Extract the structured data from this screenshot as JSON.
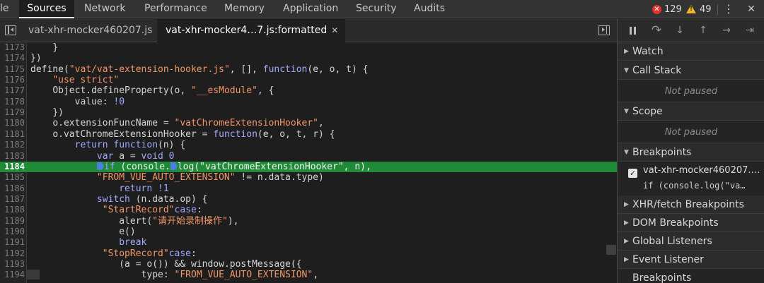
{
  "top_tabs": [
    {
      "label": "le"
    },
    {
      "label": "Sources"
    },
    {
      "label": "Network"
    },
    {
      "label": "Performance"
    },
    {
      "label": "Memory"
    },
    {
      "label": "Application"
    },
    {
      "label": "Security"
    },
    {
      "label": "Audits"
    }
  ],
  "status": {
    "errors": "129",
    "warnings": "49"
  },
  "top_icons": {
    "more": "⋮",
    "close": "✕"
  },
  "file_tabs": [
    {
      "label": "vat-xhr-mocker460207.js"
    },
    {
      "label": "vat-xhr-mocker4…7.js:formatted",
      "close": "✕"
    }
  ],
  "code_lines": [
    {
      "num": "1173",
      "indent": "    ",
      "text": "}"
    },
    {
      "num": "1174",
      "indent": "",
      "text": "})"
    },
    {
      "num": "1175",
      "indent": "",
      "pre": "define(",
      "str1": "\"vat/vat-extension-hooker.js\"",
      "mid": ", [], ",
      "kw": "function",
      "post": "(e, o, t) {"
    },
    {
      "num": "1176",
      "indent": "    ",
      "str1": "\"use strict\""
    },
    {
      "num": "1177",
      "indent": "    ",
      "pre": "Object.defineProperty(o, ",
      "str1": "\"__esModule\"",
      "post": ", {"
    },
    {
      "num": "1178",
      "indent": "        ",
      "pre": "value: ",
      "num1": "!0"
    },
    {
      "num": "1179",
      "indent": "    ",
      "text": "})"
    },
    {
      "num": "1180",
      "indent": "    ",
      "pre": "o.extensionFuncName = ",
      "str1": "\"vatChromeExtensionHooker\"",
      "post": ","
    },
    {
      "num": "1181",
      "indent": "    ",
      "pre": "o.vatChromeExtensionHooker = ",
      "kw": "function",
      "post": "(e, o, t, r) {"
    },
    {
      "num": "1182",
      "indent": "        ",
      "kw": "return function",
      "post": "(n) {"
    },
    {
      "num": "1183",
      "indent": "            ",
      "kw": "var",
      "pre2": " a = ",
      "kw2": "void",
      "num1": " 0"
    },
    {
      "num": "1184",
      "indent": "            ",
      "active": true,
      "bp1": true,
      "kw": "if",
      "pre2": " (console.",
      "bp2": true,
      "post": "log(\"vatChromeExtensionHooker\", n),"
    },
    {
      "num": "1185",
      "indent": "            ",
      "str1": "\"FROM_VUE_AUTO_EXTENSION\"",
      "post": " != n.data.type)"
    },
    {
      "num": "1186",
      "indent": "                ",
      "kw": "return",
      "num1": " !1"
    },
    {
      "num": "1187",
      "indent": "            ",
      "kw": "switch",
      "post": " (n.data.op) {"
    },
    {
      "num": "1188",
      "indent": "            ",
      "kw": "case",
      "str1": " \"StartRecord\"",
      "post": ":"
    },
    {
      "num": "1189",
      "indent": "                ",
      "pre": "alert(",
      "str1": "\"请开始录制操作\"",
      "post": "),"
    },
    {
      "num": "1190",
      "indent": "                ",
      "text": "e()"
    },
    {
      "num": "1191",
      "indent": "                ",
      "kw": "break"
    },
    {
      "num": "1192",
      "indent": "            ",
      "kw": "case",
      "str1": " \"StopRecord\"",
      "post": ":"
    },
    {
      "num": "1193",
      "indent": "                ",
      "text": "(a = o()) && window.postMessage({"
    },
    {
      "num": "1194",
      "indent": "                    ",
      "pre": "type: ",
      "str1": "\"FROM_VUE_AUTO_EXTENSION\"",
      "post": ","
    }
  ],
  "debugger": {
    "sections": {
      "watch": "Watch",
      "call_stack": "Call Stack",
      "scope": "Scope",
      "breakpoints": "Breakpoints",
      "xhr": "XHR/fetch Breakpoints",
      "dom": "DOM Breakpoints",
      "global": "Global Listeners",
      "event": "Event Listener Breakpoints"
    },
    "not_paused": "Not paused",
    "breakpoint_item": {
      "file": "vat-xhr-mocker460207.…",
      "code": "if (console.log(\"va…",
      "checked": "✓"
    },
    "icons": {
      "step_over": "↷",
      "step_into": "↓",
      "step_out": "↑",
      "step": "→",
      "deactivate": "⇥"
    }
  },
  "colors": {
    "active_line": "#1f8a37",
    "string": "#f29668",
    "keyword": "#a2a8ff",
    "error": "#e0322f",
    "warning": "#f1b928",
    "breakpoint": "#4b7ee4"
  }
}
